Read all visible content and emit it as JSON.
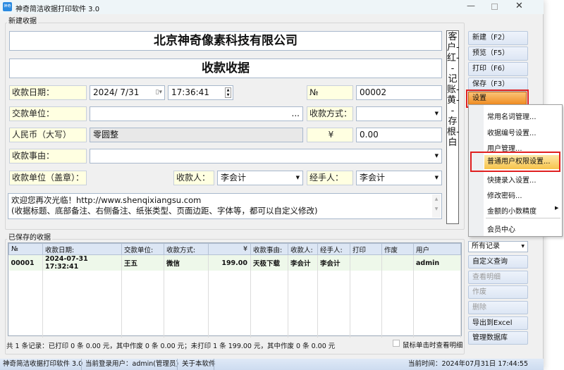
{
  "window": {
    "title": "神奇简洁收据打印软件 3.0",
    "logo_text": "神奇"
  },
  "new_receipt": {
    "group_label": "新建收据",
    "company": "北京神奇像素科技有限公司",
    "title": "收款收据",
    "date_label": "收款日期：",
    "date_value": "2024/  7/31",
    "time_value": "17:36:41",
    "no_label": "№",
    "no_value": "00002",
    "payer_label": "交款单位：",
    "payer_value": "",
    "payer_browse": "...",
    "method_label": "收款方式：",
    "method_value": "",
    "rmb_upper_label": "人民币（大写）",
    "rmb_upper_value": "零圆整",
    "yen_label": "¥",
    "amount_value": "0.00",
    "reason_label": "收款事由：",
    "reason_value": "",
    "stamp_label": "收款单位（盖章）：",
    "receiver_label": "收款人：",
    "receiver_value": "李会计",
    "handler_label": "经手人：",
    "handler_value": "李会计",
    "note_line1": "欢迎您再次光临！http://www.shenqixiangsu.com",
    "note_line2": "(收据标题、底部备注、右侧备注、纸张类型、页面边距、字体等，都可以自定义修改)",
    "side_note": "客户-红--记账-黄--存根-白"
  },
  "toolbar": {
    "new": "新建（F2）",
    "preview": "预览（F5）",
    "print": "打印（F6）",
    "save": "保存（F3）",
    "settings": "设置"
  },
  "settings_menu": {
    "items": [
      "常用名词管理...",
      "收据编号设置...",
      "用户管理...",
      "普通用户权限设置...",
      "快捷录入设置...",
      "修改密码...",
      "金额的小数精度",
      "会员中心"
    ],
    "highlighted": "普通用户权限设置..."
  },
  "saved": {
    "group_label": "已保存的收据",
    "columns": [
      "№",
      "收款日期:",
      "交款单位:",
      "收款方式:",
      "¥",
      "收款事由:",
      "收款人:",
      "经手人:",
      "打印",
      "作废",
      "用户"
    ],
    "rows": [
      [
        "00001",
        "2024-07-31 17:32:41",
        "王五",
        "微信",
        "199.00",
        "天极下载",
        "李会计",
        "李会计",
        "",
        "",
        "admin"
      ]
    ],
    "summary": "共 1 条记录：已打印 0 条 0.00 元，其中作废 0 条 0.00 元；未打印 1 条 199.00 元，其中作废 0 条 0.00 元",
    "click_detail_label": "鼠标单击时查看明细",
    "filter_value": "所有记录",
    "buttons": {
      "custom_query": "自定义查询",
      "view_detail": "查看明细",
      "void": "作废",
      "delete": "删除",
      "export": "导出到Excel",
      "manage_db": "管理数据库"
    }
  },
  "statusbar": {
    "app": "神奇简洁收据打印软件 3.0",
    "user": "当前登录用户：admin(管理员)",
    "about": "关于本软件",
    "time": "当前时间：2024年07月31日 17:44:55"
  },
  "colors": {
    "label_bg": "#ffffe1",
    "highlight": "#f5a623",
    "outline": "#e02020",
    "row_bg": "#eef8ea"
  }
}
